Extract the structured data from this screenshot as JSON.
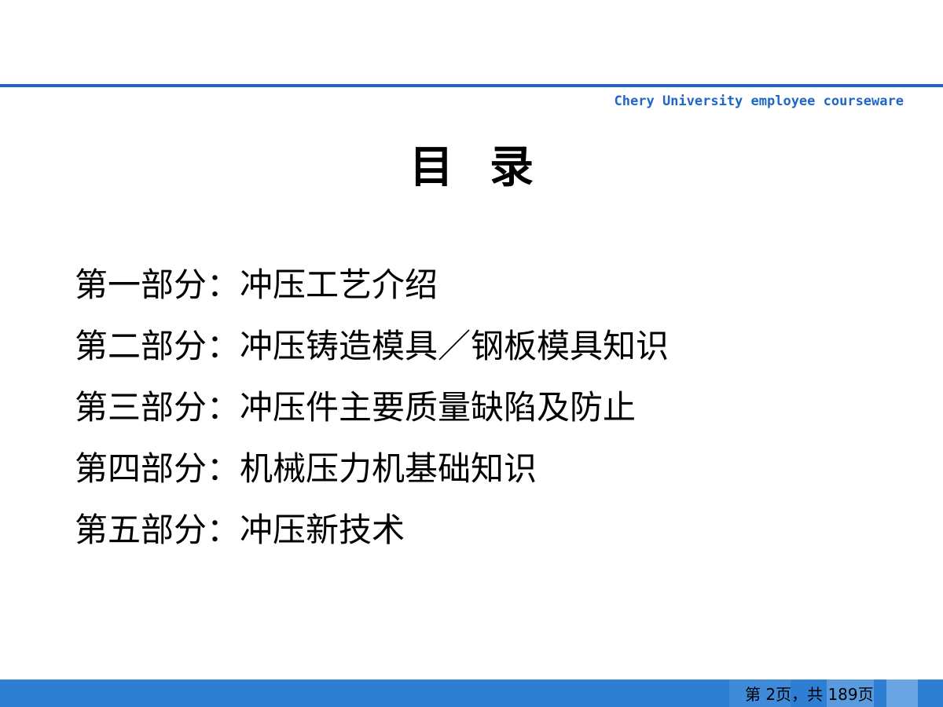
{
  "header": {
    "tagline": "Chery University employee courseware"
  },
  "title": "目录",
  "toc": [
    "第一部分：冲压工艺介绍",
    "第二部分：冲压铸造模具／钢板模具知识",
    "第三部分：冲压件主要质量缺陷及防止",
    "第四部分：机械压力机基础知识",
    "第五部分：冲压新技术"
  ],
  "footer": {
    "page_counter": "第 2页，共 189页"
  },
  "colors": {
    "accent": "#1f66c7",
    "footer_bar": "#2e7fd4"
  }
}
